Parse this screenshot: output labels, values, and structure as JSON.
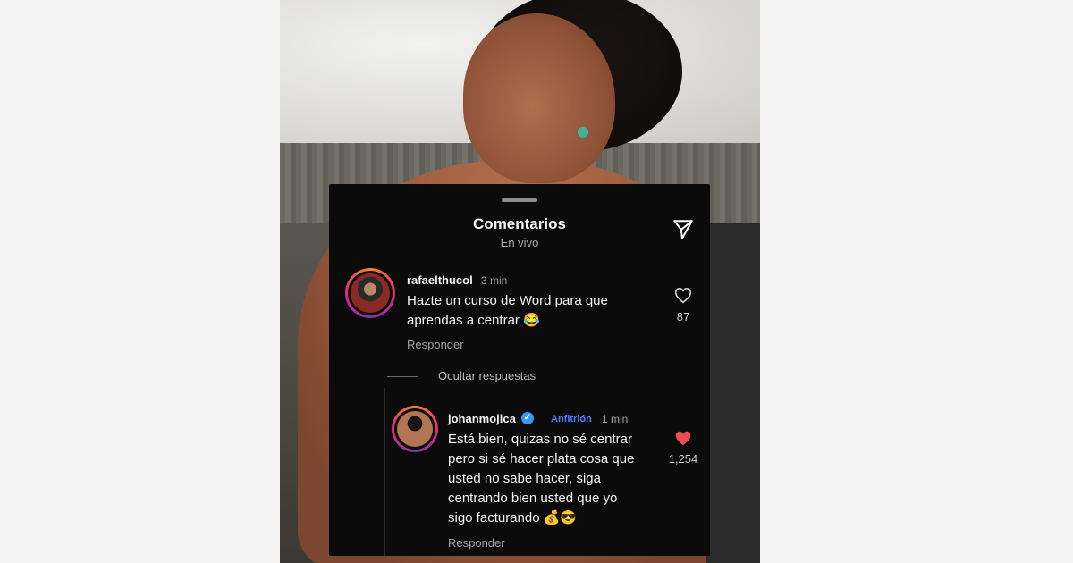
{
  "panel": {
    "title": "Comentarios",
    "subtitle": "En vivo"
  },
  "comments": [
    {
      "username": "rafaelthucol",
      "time": "3 min",
      "text_line1": "Hazte un curso de Word para que",
      "text_line2": "aprendas a centrar 😂",
      "reply_label": "Responder",
      "likes": "87",
      "liked": false
    }
  ],
  "hide_replies": "Ocultar respuestas",
  "reply": {
    "username": "johanmojica",
    "verified": true,
    "host_badge": "Anfitrión",
    "time": "1 min",
    "lines": [
      "Está bien, quizas no sé centrar",
      "pero si sé hacer plata cosa que",
      "usted no sabe hacer, siga",
      "centrando bien usted que yo",
      "sigo facturando 💰😎"
    ],
    "reply_label": "Responder",
    "likes": "1,254",
    "liked": true
  },
  "colors": {
    "panel_bg": "#0b0b0c",
    "like_red": "#ed4956",
    "host_blue": "#4c7dff",
    "verified_blue": "#3897f0"
  },
  "icons": [
    "send-icon",
    "heart-outline-icon",
    "heart-filled-icon",
    "verified-icon"
  ]
}
